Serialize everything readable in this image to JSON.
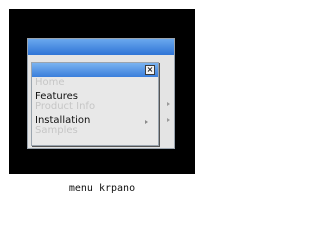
{
  "menu": {
    "close_glyph": "×",
    "items": [
      {
        "label": "Home",
        "state": "faded",
        "has_submenu": false
      },
      {
        "label": "Features",
        "state": "normal",
        "has_submenu": false
      },
      {
        "label": "Product Info",
        "state": "faded",
        "has_submenu": true
      },
      {
        "label": "Installation",
        "state": "normal",
        "has_submenu": true
      },
      {
        "label": "Samples",
        "state": "faded",
        "has_submenu": false
      }
    ]
  },
  "caption": "menu krpano",
  "colors": {
    "titlebar": "#3a7edb",
    "frame": "#000000",
    "menu_bg": "#e8e8e8",
    "faded_text": "#c6c6c6"
  }
}
